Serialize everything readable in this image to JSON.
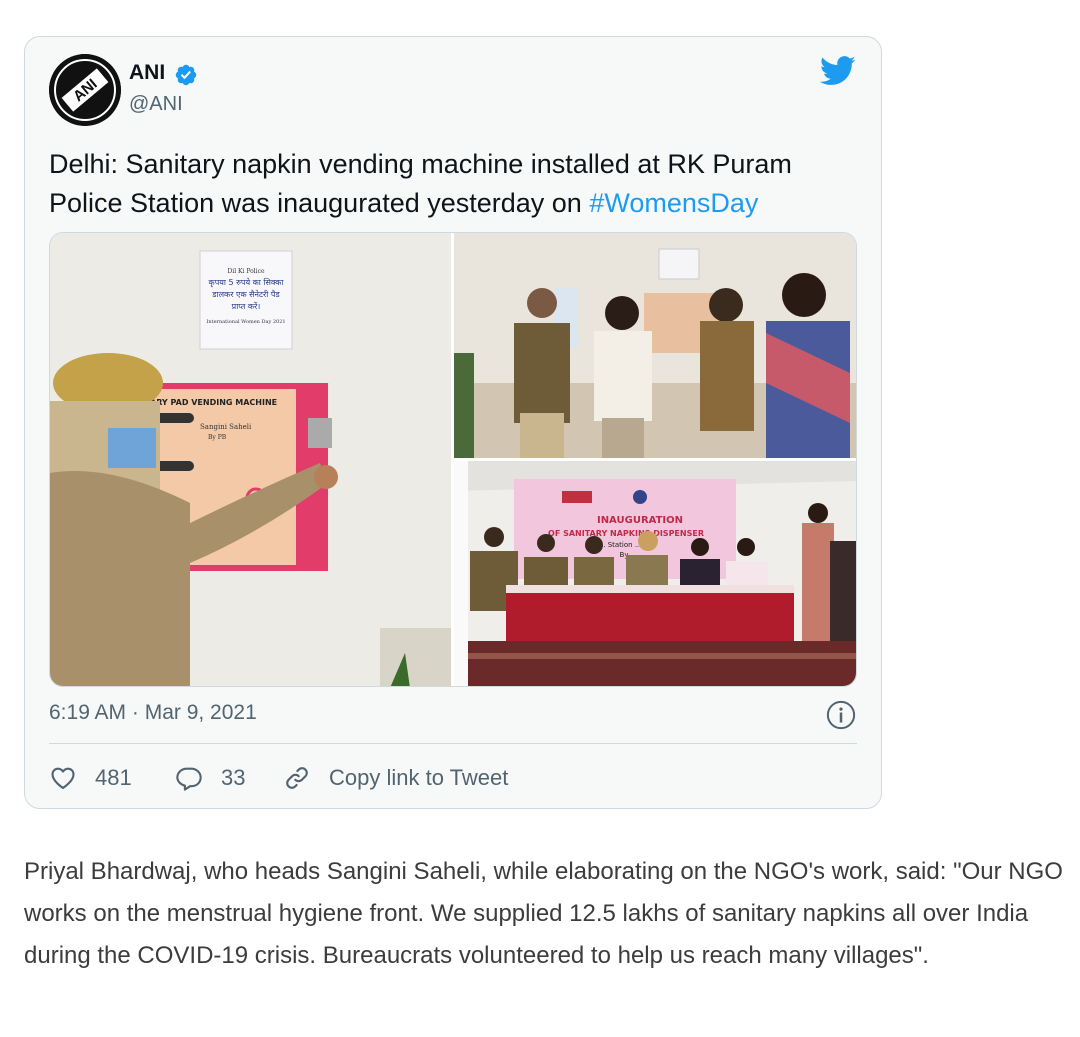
{
  "tweet": {
    "author": {
      "name": "ANI",
      "handle": "@ANI",
      "avatar_text": "ANI",
      "verified": true
    },
    "text_main": "Delhi: Sanitary napkin vending machine installed at RK Puram Police Station was inaugurated yesterday on ",
    "hashtag": "#WomensDay",
    "media": {
      "photo_left": {
        "sign_lines": [
          "Dil Ki Police",
          "कृपया 5 रुपये का सिक्का",
          "डालकर एक सैनेटरी पैड",
          "प्राप्त करें।",
          "International Women Day 2021"
        ],
        "machine_label": "ARY PAD VENDING MACHINE",
        "machine_brand": [
          "Sangini Saheli",
          "By PB"
        ]
      },
      "photo_bottom_right": {
        "banner_title": "INAUGURATION",
        "banner_sub": "OF SANITARY NAPKINS DISPENSER",
        "banner_line": "At ... Station ... am",
        "banner_by": "By"
      }
    },
    "timestamp": "6:19 AM · Mar 9, 2021",
    "likes": "481",
    "replies": "33",
    "copy_link_label": "Copy link to Tweet",
    "colors": {
      "accent": "#1d9bf0",
      "text": "#0f1419",
      "muted": "#536471",
      "card_bg": "#f7f9f9",
      "border": "#cfd9de"
    },
    "icons": [
      "verified-badge-icon",
      "twitter-bird-icon",
      "info-icon",
      "heart-icon",
      "reply-bubble-icon",
      "link-icon"
    ]
  },
  "article": {
    "paragraph": "Priyal Bhardwaj, who heads Sangini Saheli, while elaborating on the NGO's work, said: \"Our NGO works on the menstrual hygiene front. We supplied 12.5 lakhs of sanitary napkins all over India during the COVID-19 crisis. Bureaucrats volunteered to help us reach many villages\"."
  }
}
